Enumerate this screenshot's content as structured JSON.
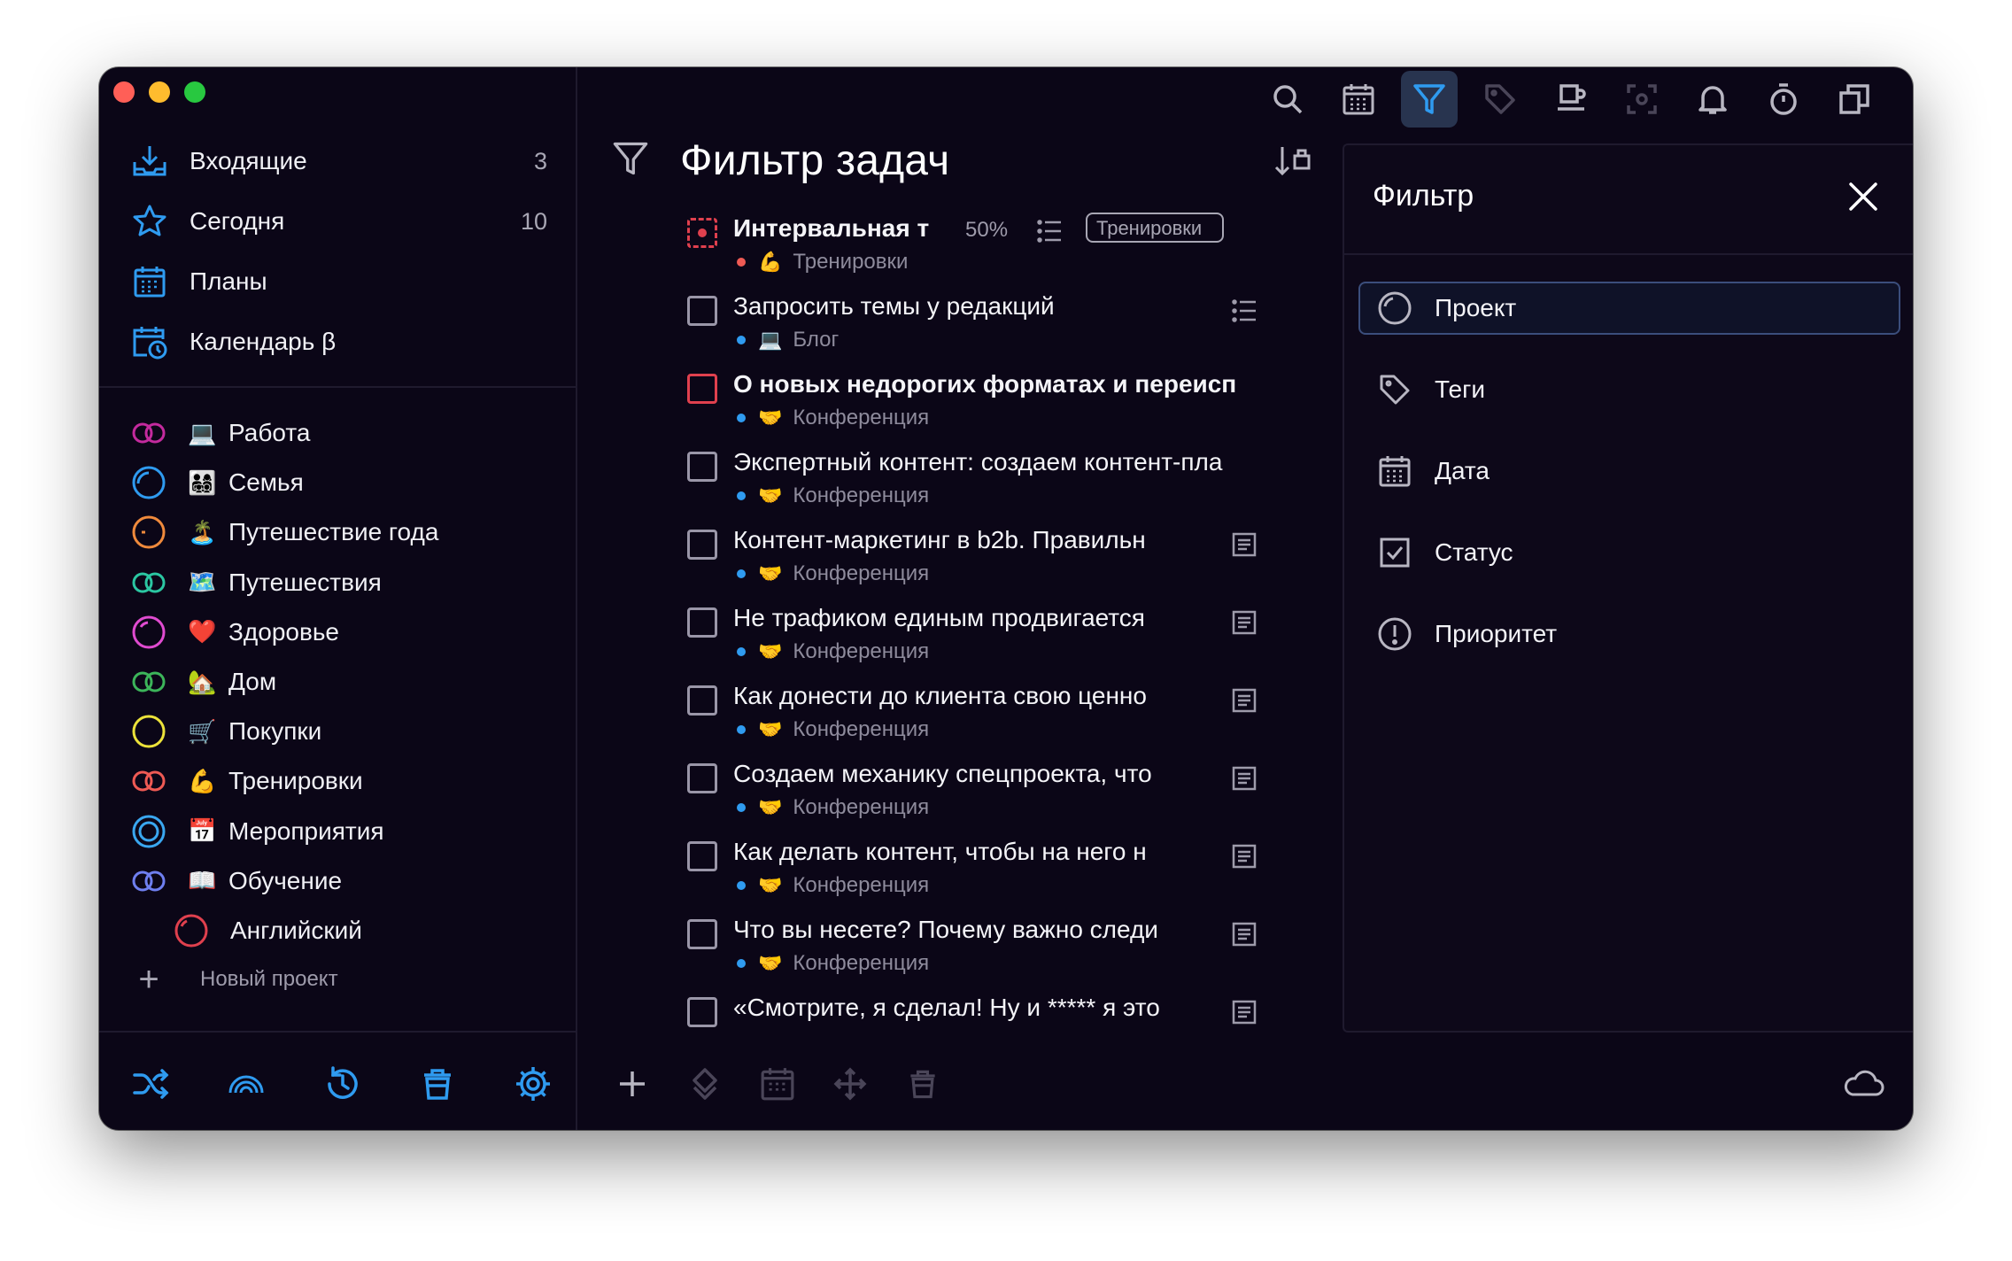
{
  "colors": {
    "accent": "#2f9bf0",
    "window_bg": "#0b0617",
    "danger": "#e0404e"
  },
  "sidebar": {
    "nav": [
      {
        "label": "Входящие",
        "count": "3",
        "icon": "inbox-icon"
      },
      {
        "label": "Сегодня",
        "count": "10",
        "icon": "star-icon"
      },
      {
        "label": "Планы",
        "count": "",
        "icon": "calendar-grid-icon"
      },
      {
        "label": "Календарь β",
        "count": "",
        "icon": "calendar-clock-icon"
      }
    ],
    "projects": [
      {
        "label": "Работа",
        "emoji": "💻",
        "ring_color": "#c42a9e",
        "ring": "double"
      },
      {
        "label": "Семья",
        "emoji": "👨‍👩‍👧‍👦",
        "ring_color": "#2f9bf0",
        "ring": "partial"
      },
      {
        "label": "Путешествие года",
        "emoji": "🏝️",
        "ring_color": "#f08a3c",
        "ring": "partial"
      },
      {
        "label": "Путешествия",
        "emoji": "🗺️",
        "ring_color": "#2bc7a2",
        "ring": "double"
      },
      {
        "label": "Здоровье",
        "emoji": "❤️",
        "ring_color": "#e04bd0",
        "ring": "partial"
      },
      {
        "label": "Дом",
        "emoji": "🏡",
        "ring_color": "#3cb55a",
        "ring": "double"
      },
      {
        "label": "Покупки",
        "emoji": "🛒",
        "ring_color": "#ece23a",
        "ring": "full"
      },
      {
        "label": "Тренировки",
        "emoji": "💪",
        "ring_color": "#ef5a54",
        "ring": "double"
      },
      {
        "label": "Мероприятия",
        "emoji": "📅",
        "ring_color": "#3aa7f0",
        "ring": "target"
      },
      {
        "label": "Обучение",
        "emoji": "📖",
        "ring_color": "#6f7ff0",
        "ring": "double"
      },
      {
        "label": "Английский",
        "emoji": "",
        "ring_color": "#e0404e",
        "ring": "partial",
        "sub": true
      }
    ],
    "new_project_label": "Новый проект",
    "bottom_icons": [
      "shuffle-icon",
      "rainbow-icon",
      "history-icon",
      "trash-icon",
      "settings-icon"
    ]
  },
  "main": {
    "title": "Фильтр задач",
    "toolbar_icons": [
      "search-icon",
      "calendar-icon",
      "filter-icon",
      "tag-icon",
      "coffee-icon",
      "focus-icon",
      "bell-icon",
      "timer-icon",
      "copy-icon"
    ],
    "tasks": [
      {
        "title": "Интервальная т",
        "bold": true,
        "project": "Тренировки",
        "dot": "#ef5a54",
        "emoji": "💪",
        "pct": "50%",
        "tag": "Тренировки",
        "check": "dashed"
      },
      {
        "title": "Запросить темы у редакций",
        "bold": false,
        "project": "Блог",
        "dot": "#2f9bf0",
        "emoji": "💻",
        "icon": "list"
      },
      {
        "title": "О новых недорогих форматах и переисп",
        "bold": true,
        "project": "Конференция",
        "dot": "#2f9bf0",
        "emoji": "🤝",
        "check": "red"
      },
      {
        "title": "Экспертный контент: создаем контент-пла",
        "bold": false,
        "project": "Конференция",
        "dot": "#2f9bf0",
        "emoji": "🤝"
      },
      {
        "title": "Контент-маркетинг в b2b. Правильн",
        "bold": false,
        "project": "Конференция",
        "dot": "#2f9bf0",
        "emoji": "🤝",
        "icon": "note"
      },
      {
        "title": "Не трафиком единым продвигается",
        "bold": false,
        "project": "Конференция",
        "dot": "#2f9bf0",
        "emoji": "🤝",
        "icon": "note"
      },
      {
        "title": "Как донести до клиента свою ценно",
        "bold": false,
        "project": "Конференция",
        "dot": "#2f9bf0",
        "emoji": "🤝",
        "icon": "note"
      },
      {
        "title": "Создаем механику спецпроекта, что",
        "bold": false,
        "project": "Конференция",
        "dot": "#2f9bf0",
        "emoji": "🤝",
        "icon": "note"
      },
      {
        "title": "Как делать контент, чтобы на него н",
        "bold": false,
        "project": "Конференция",
        "dot": "#2f9bf0",
        "emoji": "🤝",
        "icon": "note"
      },
      {
        "title": "Что вы несете? Почему важно следи",
        "bold": false,
        "project": "Конференция",
        "dot": "#2f9bf0",
        "emoji": "🤝",
        "icon": "note"
      },
      {
        "title": "«Смотрите, я сделал! Ну и ***** я это",
        "bold": false,
        "project": "",
        "dot": "#2f9bf0",
        "emoji": "",
        "icon": "note"
      }
    ],
    "bottom_icons": [
      "add-icon",
      "priority-icon",
      "calendar-icon",
      "move-icon",
      "trash-icon"
    ]
  },
  "filter_panel": {
    "title": "Фильтр",
    "items": [
      {
        "label": "Проект",
        "icon": "project-ring-icon",
        "selected": true
      },
      {
        "label": "Теги",
        "icon": "tag-icon",
        "selected": false
      },
      {
        "label": "Дата",
        "icon": "calendar-icon",
        "selected": false
      },
      {
        "label": "Статус",
        "icon": "checkbox-icon",
        "selected": false
      },
      {
        "label": "Приоритет",
        "icon": "priority-alert-icon",
        "selected": false
      }
    ]
  }
}
